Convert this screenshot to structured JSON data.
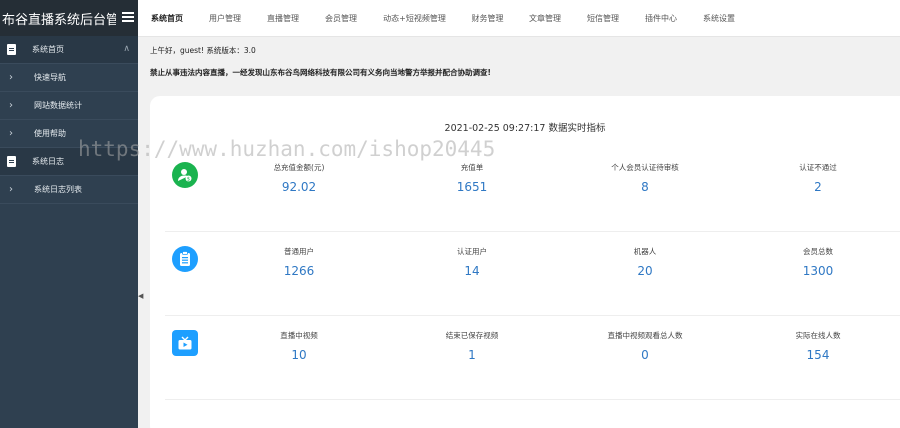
{
  "brand": {
    "title": "布谷直播系统后台管理"
  },
  "sidebar": {
    "items": [
      {
        "label": "系统首页",
        "type": "group"
      },
      {
        "label": "快速导航",
        "type": "sub"
      },
      {
        "label": "网站数据统计",
        "type": "sub"
      },
      {
        "label": "使用帮助",
        "type": "sub"
      },
      {
        "label": "系统日志",
        "type": "group"
      },
      {
        "label": "系统日志列表",
        "type": "sub"
      }
    ]
  },
  "tabs": [
    {
      "label": "系统首页",
      "active": true
    },
    {
      "label": "用户管理"
    },
    {
      "label": "直播管理"
    },
    {
      "label": "会员管理"
    },
    {
      "label": "动态+短视频管理"
    },
    {
      "label": "财务管理"
    },
    {
      "label": "文章管理"
    },
    {
      "label": "短信管理"
    },
    {
      "label": "插件中心"
    },
    {
      "label": "系统设置"
    }
  ],
  "notice": {
    "greeting": "上午好，guest! 系统版本：3.0",
    "warning": "禁止从事违法内容直播，一经发现山东布谷鸟网络科技有限公司有义务向当地警方举报并配合协助调查!"
  },
  "panel": {
    "title": "2021-02-25 09:27:17 数据实时指标"
  },
  "rows": [
    {
      "icon": "money-user-icon",
      "color": "#1ab34f",
      "stats": [
        {
          "label": "总充值金额(元)",
          "value": "92.02"
        },
        {
          "label": "充值单",
          "value": "1651"
        },
        {
          "label": "个人会员认证待审核",
          "value": "8"
        },
        {
          "label": "认证不通过",
          "value": "2"
        }
      ]
    },
    {
      "icon": "clipboard-icon",
      "color": "#1e9fff",
      "stats": [
        {
          "label": "普通用户",
          "value": "1266"
        },
        {
          "label": "认证用户",
          "value": "14"
        },
        {
          "label": "机器人",
          "value": "20"
        },
        {
          "label": "会员总数",
          "value": "1300"
        }
      ]
    },
    {
      "icon": "tv-icon",
      "color": "#1e9fff",
      "stats": [
        {
          "label": "直播中视频",
          "value": "10"
        },
        {
          "label": "结束已保存视频",
          "value": "1"
        },
        {
          "label": "直播中视频观看总人数",
          "value": "0"
        },
        {
          "label": "实际在线人数",
          "value": "154"
        }
      ]
    }
  ],
  "watermark": "https://www.huzhan.com/ishop20445"
}
